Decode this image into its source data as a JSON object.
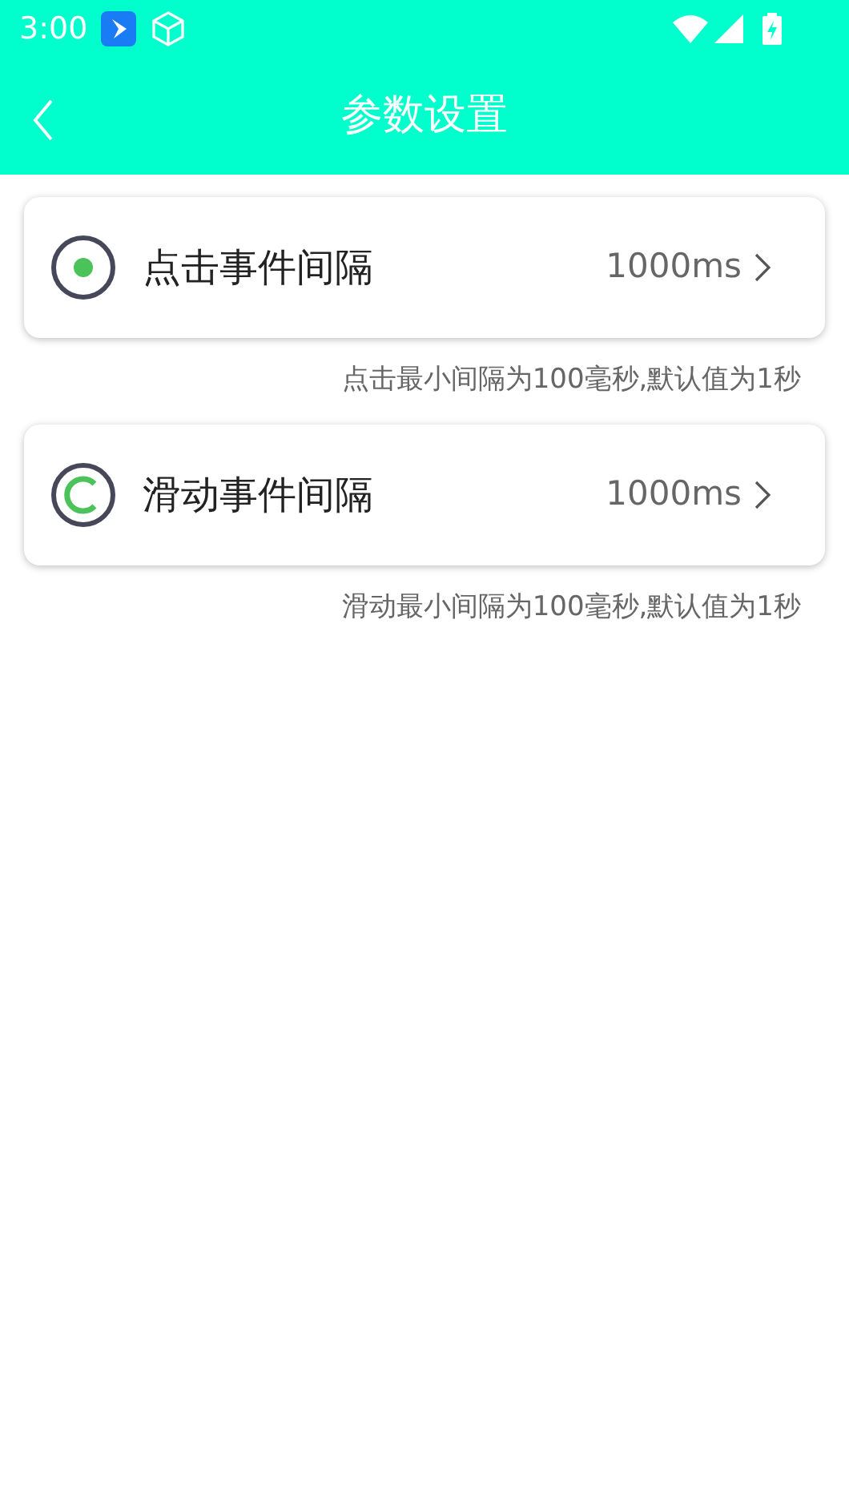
{
  "status_bar": {
    "time": "3:00"
  },
  "app_bar": {
    "title": "参数设置"
  },
  "settings": [
    {
      "kind": "tap",
      "label": "点击事件间隔",
      "value": "1000ms",
      "hint": "点击最小间隔为100毫秒,默认值为1秒"
    },
    {
      "kind": "swipe",
      "label": "滑动事件间隔",
      "value": "1000ms",
      "hint": "滑动最小间隔为100毫秒,默认值为1秒"
    }
  ]
}
